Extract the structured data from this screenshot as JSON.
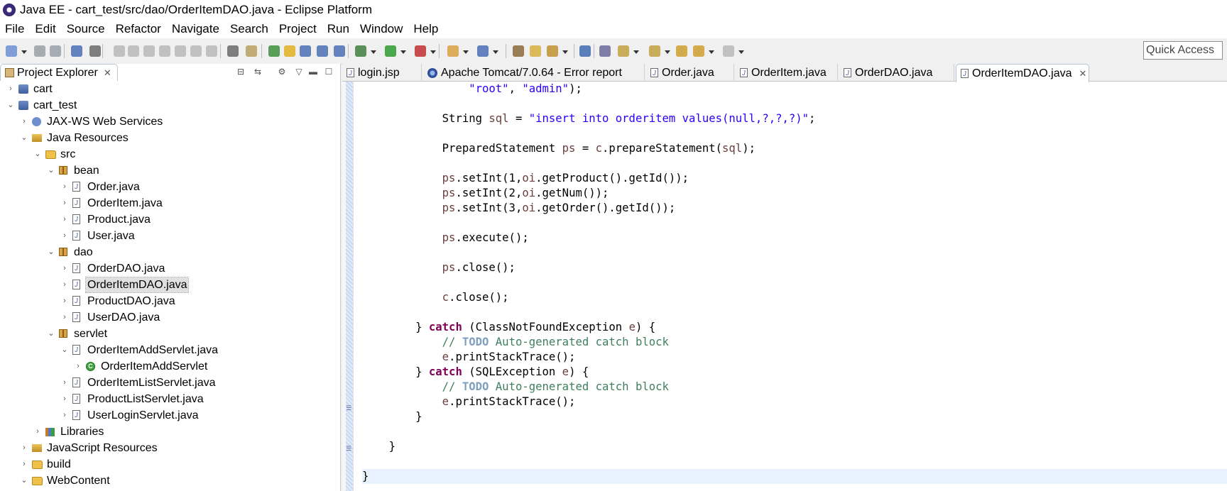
{
  "window": {
    "title": "Java EE - cart_test/src/dao/OrderItemDAO.java - Eclipse Platform"
  },
  "menu": [
    "File",
    "Edit",
    "Source",
    "Refactor",
    "Navigate",
    "Search",
    "Project",
    "Run",
    "Window",
    "Help"
  ],
  "quick_access": {
    "label": "Quick Access"
  },
  "explorer": {
    "title": "Project Explorer",
    "tree": [
      {
        "label": "cart",
        "level": 0,
        "icon": "project",
        "expanded": false
      },
      {
        "label": "cart_test",
        "level": 0,
        "icon": "project",
        "expanded": true
      },
      {
        "label": "JAX-WS Web Services",
        "level": 1,
        "icon": "webservice",
        "expanded": false
      },
      {
        "label": "Java Resources",
        "level": 1,
        "icon": "javaresources",
        "expanded": true
      },
      {
        "label": "src",
        "level": 2,
        "icon": "sourcefolder",
        "expanded": true
      },
      {
        "label": "bean",
        "level": 3,
        "icon": "package",
        "expanded": true
      },
      {
        "label": "Order.java",
        "level": 4,
        "icon": "java-file",
        "expanded": false
      },
      {
        "label": "OrderItem.java",
        "level": 4,
        "icon": "java-file",
        "expanded": false
      },
      {
        "label": "Product.java",
        "level": 4,
        "icon": "java-file",
        "expanded": false
      },
      {
        "label": "User.java",
        "level": 4,
        "icon": "java-file",
        "expanded": false
      },
      {
        "label": "dao",
        "level": 3,
        "icon": "package",
        "expanded": true
      },
      {
        "label": "OrderDAO.java",
        "level": 4,
        "icon": "java-file",
        "expanded": false
      },
      {
        "label": "OrderItemDAO.java",
        "level": 4,
        "icon": "java-file",
        "expanded": false,
        "selected": true
      },
      {
        "label": "ProductDAO.java",
        "level": 4,
        "icon": "java-file",
        "expanded": false
      },
      {
        "label": "UserDAO.java",
        "level": 4,
        "icon": "java-file",
        "expanded": false
      },
      {
        "label": "servlet",
        "level": 3,
        "icon": "package",
        "expanded": true
      },
      {
        "label": "OrderItemAddServlet.java",
        "level": 4,
        "icon": "java-file",
        "expanded": true
      },
      {
        "label": "OrderItemAddServlet",
        "level": 5,
        "icon": "class",
        "expanded": false
      },
      {
        "label": "OrderItemListServlet.java",
        "level": 4,
        "icon": "java-file",
        "expanded": false
      },
      {
        "label": "ProductListServlet.java",
        "level": 4,
        "icon": "java-file",
        "expanded": false
      },
      {
        "label": "UserLoginServlet.java",
        "level": 4,
        "icon": "java-file",
        "expanded": false
      },
      {
        "label": "Libraries",
        "level": 2,
        "icon": "library",
        "expanded": false
      },
      {
        "label": "JavaScript Resources",
        "level": 1,
        "icon": "js-resources",
        "expanded": false
      },
      {
        "label": "build",
        "level": 1,
        "icon": "folder",
        "expanded": false
      },
      {
        "label": "WebContent",
        "level": 1,
        "icon": "folder",
        "expanded": true
      }
    ]
  },
  "editor": {
    "tabs": [
      {
        "label": "login.jsp",
        "icon": "jsp-file",
        "active": false
      },
      {
        "label": "Apache Tomcat/7.0.64 - Error report",
        "icon": "web-browser",
        "active": false
      },
      {
        "label": "Order.java",
        "icon": "java-file",
        "active": false
      },
      {
        "label": "OrderItem.java",
        "icon": "java-file",
        "active": false
      },
      {
        "label": "OrderDAO.java",
        "icon": "java-file",
        "active": false
      },
      {
        "label": "OrderItemDAO.java",
        "icon": "java-file",
        "active": true
      }
    ],
    "code_lines": [
      {
        "indent": 16,
        "tokens": [
          [
            "s",
            "\"root\""
          ],
          [
            "p",
            ", "
          ],
          [
            "s",
            "\"admin\""
          ],
          [
            "p",
            ");"
          ]
        ]
      },
      {
        "indent": 0,
        "tokens": []
      },
      {
        "indent": 12,
        "tokens": [
          [
            "p",
            "String "
          ],
          [
            "v",
            "sql"
          ],
          [
            "p",
            " = "
          ],
          [
            "s",
            "\"insert into orderitem values(null,?,?,?)\""
          ],
          [
            "p",
            ";"
          ]
        ]
      },
      {
        "indent": 0,
        "tokens": []
      },
      {
        "indent": 12,
        "tokens": [
          [
            "p",
            "PreparedStatement "
          ],
          [
            "v",
            "ps"
          ],
          [
            "p",
            " = "
          ],
          [
            "v",
            "c"
          ],
          [
            "p",
            ".prepareStatement("
          ],
          [
            "v",
            "sql"
          ],
          [
            "p",
            ");"
          ]
        ]
      },
      {
        "indent": 0,
        "tokens": []
      },
      {
        "indent": 12,
        "tokens": [
          [
            "v",
            "ps"
          ],
          [
            "p",
            ".setInt(1,"
          ],
          [
            "v",
            "oi"
          ],
          [
            "p",
            ".getProduct().getId());"
          ]
        ]
      },
      {
        "indent": 12,
        "tokens": [
          [
            "v",
            "ps"
          ],
          [
            "p",
            ".setInt(2,"
          ],
          [
            "v",
            "oi"
          ],
          [
            "p",
            ".getNum());"
          ]
        ]
      },
      {
        "indent": 12,
        "tokens": [
          [
            "v",
            "ps"
          ],
          [
            "p",
            ".setInt(3,"
          ],
          [
            "v",
            "oi"
          ],
          [
            "p",
            ".getOrder().getId());"
          ]
        ]
      },
      {
        "indent": 0,
        "tokens": []
      },
      {
        "indent": 12,
        "tokens": [
          [
            "v",
            "ps"
          ],
          [
            "p",
            ".execute();"
          ]
        ]
      },
      {
        "indent": 0,
        "tokens": []
      },
      {
        "indent": 12,
        "tokens": [
          [
            "v",
            "ps"
          ],
          [
            "p",
            ".close();"
          ]
        ]
      },
      {
        "indent": 0,
        "tokens": []
      },
      {
        "indent": 12,
        "tokens": [
          [
            "v",
            "c"
          ],
          [
            "p",
            ".close();"
          ]
        ]
      },
      {
        "indent": 0,
        "tokens": []
      },
      {
        "indent": 8,
        "tokens": [
          [
            "p",
            "} "
          ],
          [
            "k",
            "catch"
          ],
          [
            "p",
            " (ClassNotFoundException "
          ],
          [
            "v",
            "e"
          ],
          [
            "p",
            ") {"
          ]
        ]
      },
      {
        "indent": 12,
        "tokens": [
          [
            "c",
            "// "
          ],
          [
            "t",
            "TODO"
          ],
          [
            "c",
            " Auto-generated catch block"
          ]
        ]
      },
      {
        "indent": 12,
        "tokens": [
          [
            "v",
            "e"
          ],
          [
            "p",
            ".printStackTrace();"
          ]
        ]
      },
      {
        "indent": 8,
        "tokens": [
          [
            "p",
            "} "
          ],
          [
            "k",
            "catch"
          ],
          [
            "p",
            " (SQLException "
          ],
          [
            "v",
            "e"
          ],
          [
            "p",
            ") {"
          ]
        ]
      },
      {
        "indent": 12,
        "tokens": [
          [
            "c",
            "// "
          ],
          [
            "t",
            "TODO"
          ],
          [
            "c",
            " Auto-generated catch block"
          ]
        ]
      },
      {
        "indent": 12,
        "tokens": [
          [
            "v",
            "e"
          ],
          [
            "p",
            ".printStackTrace();"
          ]
        ]
      },
      {
        "indent": 8,
        "tokens": [
          [
            "p",
            "}"
          ]
        ]
      },
      {
        "indent": 0,
        "tokens": []
      },
      {
        "indent": 4,
        "tokens": [
          [
            "p",
            "}"
          ]
        ]
      },
      {
        "indent": 0,
        "tokens": []
      },
      {
        "indent": 0,
        "tokens": [
          [
            "p",
            "}"
          ]
        ],
        "highlight": true
      }
    ]
  },
  "colors": {
    "keyword": "#7f0055",
    "string": "#2a00ff",
    "variable": "#6a3e3e",
    "comment": "#3f7f5f",
    "todo": "#7f9fbf",
    "current_line": "#e8f2fe"
  }
}
